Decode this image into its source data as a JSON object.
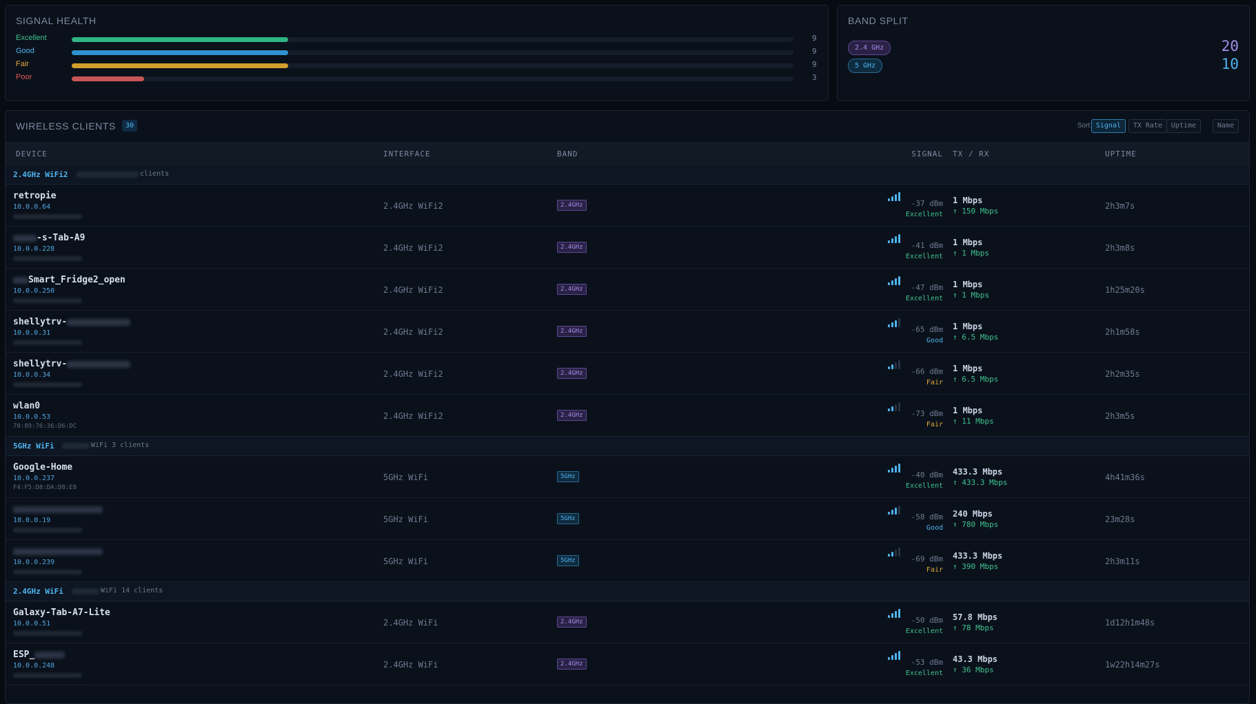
{
  "signal_health": {
    "title": "SIGNAL HEALTH",
    "rows": [
      {
        "label": "Excellent",
        "count": "9",
        "fraction": 0.3,
        "color": "#2fb583",
        "label_color": "#3ec28f"
      },
      {
        "label": "Good",
        "count": "9",
        "fraction": 0.3,
        "color": "#2f93cf",
        "label_color": "#4fb4f0"
      },
      {
        "label": "Fair",
        "count": "9",
        "fraction": 0.3,
        "color": "#d39f2d",
        "label_color": "#e0a93a"
      },
      {
        "label": "Poor",
        "count": "3",
        "fraction": 0.1,
        "color": "#c85656",
        "label_color": "#e05858"
      }
    ]
  },
  "band_split": {
    "title": "BAND SPLIT",
    "bands": [
      {
        "label": "2.4 GHz",
        "value": "20",
        "bg": "#2a2146",
        "fg": "#a48ce8",
        "border": "#5b4a96",
        "value_color": "#a48ce8"
      },
      {
        "label": "5 GHz",
        "value": "10",
        "bg": "#0e2b3f",
        "fg": "#4fb4f0",
        "border": "#2b6a92",
        "value_color": "#4fb4f0"
      }
    ]
  },
  "clients": {
    "title": "WIRELESS CLIENTS",
    "count": "30",
    "sort_label": "Sort:",
    "sort_buttons": [
      {
        "label": "Signal",
        "active": true
      },
      {
        "label": "TX Rate",
        "active": false
      },
      {
        "label": "Uptime",
        "active": false
      },
      {
        "label": "Name",
        "active": false
      }
    ],
    "headers": [
      "DEVICE",
      "INTERFACE",
      "BAND",
      "SIGNAL",
      "TX / RX",
      "UPTIME"
    ],
    "groups": [
      {
        "name": "2.4GHz WiFi2",
        "suffix": "clients",
        "rows": [
          {
            "name": "retropie",
            "ip": "10.0.0.64",
            "mac": "",
            "iface": "2.4GHz WiFi2",
            "band": "2.4GHz",
            "bars": 4,
            "dbm": "-37 dBm",
            "quality": "Excellent",
            "tx": "1 Mbps",
            "rx": "↑ 150 Mbps",
            "uptime": "2h3m7s"
          },
          {
            "name": "-s-Tab-A9",
            "ip": "10.0.0.228",
            "mac": "",
            "iface": "2.4GHz WiFi2",
            "band": "2.4GHz",
            "bars": 4,
            "dbm": "-41 dBm",
            "quality": "Excellent",
            "tx": "1 Mbps",
            "rx": "↑ 1 Mbps",
            "uptime": "2h3m8s",
            "prefix_blur": 34
          },
          {
            "name": "Smart_Fridge2_open",
            "ip": "10.0.0.250",
            "mac": "",
            "iface": "2.4GHz WiFi2",
            "band": "2.4GHz",
            "bars": 4,
            "dbm": "-47 dBm",
            "quality": "Excellent",
            "tx": "1 Mbps",
            "rx": "↑ 1 Mbps",
            "uptime": "1h25m20s",
            "prefix_blur": 22
          },
          {
            "name": "shellytrv-",
            "ip": "10.0.0.31",
            "mac": "",
            "iface": "2.4GHz WiFi2",
            "band": "2.4GHz",
            "bars": 3,
            "dbm": "-65 dBm",
            "quality": "Good",
            "tx": "1 Mbps",
            "rx": "↑ 6.5 Mbps",
            "uptime": "2h1m58s",
            "suffix_blur": 92
          },
          {
            "name": "shellytrv-",
            "ip": "10.0.0.34",
            "mac": "",
            "iface": "2.4GHz WiFi2",
            "band": "2.4GHz",
            "bars": 2,
            "dbm": "-66 dBm",
            "quality": "Fair",
            "tx": "1 Mbps",
            "rx": "↑ 6.5 Mbps",
            "uptime": "2h2m35s",
            "suffix_blur": 92
          },
          {
            "name": "wlan0",
            "ip": "10.0.0.53",
            "mac": "70:89:76:36:D6:DC",
            "iface": "2.4GHz WiFi2",
            "band": "2.4GHz",
            "bars": 2,
            "dbm": "-73 dBm",
            "quality": "Fair",
            "tx": "1 Mbps",
            "rx": "↑ 11 Mbps",
            "uptime": "2h3m5s"
          }
        ]
      },
      {
        "name": "5GHz WiFi",
        "suffix": "WiFi 3 clients",
        "rows": [
          {
            "name": "Google-Home",
            "ip": "10.0.0.237",
            "mac": "F4:F5:D8:DA:D8:E8",
            "iface": "5GHz WiFi",
            "band": "5GHz",
            "bars": 4,
            "dbm": "-40 dBm",
            "quality": "Excellent",
            "tx": "433.3 Mbps",
            "rx": "↑ 433.3 Mbps",
            "uptime": "4h41m36s"
          },
          {
            "name": "",
            "ip": "10.0.0.19",
            "mac": "",
            "iface": "5GHz WiFi",
            "band": "5GHz",
            "bars": 3,
            "dbm": "-58 dBm",
            "quality": "Good",
            "tx": "240 Mbps",
            "rx": "↑ 780 Mbps",
            "uptime": "23m28s",
            "name_blur": 130
          },
          {
            "name": "",
            "ip": "10.0.0.239",
            "mac": "",
            "iface": "5GHz WiFi",
            "band": "5GHz",
            "bars": 2,
            "dbm": "-69 dBm",
            "quality": "Fair",
            "tx": "433.3 Mbps",
            "rx": "↑ 390 Mbps",
            "uptime": "2h3m11s",
            "name_blur": 130
          }
        ]
      },
      {
        "name": "2.4GHz WiFi",
        "suffix": "WiFi 14 clients",
        "rows": [
          {
            "name": "Galaxy-Tab-A7-Lite",
            "ip": "10.0.0.51",
            "mac": "",
            "iface": "2.4GHz WiFi",
            "band": "2.4GHz",
            "bars": 4,
            "dbm": "-50 dBm",
            "quality": "Excellent",
            "tx": "57.8 Mbps",
            "rx": "↑ 78 Mbps",
            "uptime": "1d12h1m48s"
          },
          {
            "name": "ESP_",
            "ip": "10.0.0.248",
            "mac": "",
            "iface": "2.4GHz WiFi",
            "band": "2.4GHz",
            "bars": 4,
            "dbm": "-53 dBm",
            "quality": "Excellent",
            "tx": "43.3 Mbps",
            "rx": "↑ 36 Mbps",
            "uptime": "1w22h14m27s",
            "suffix_blur": 44
          }
        ]
      }
    ]
  }
}
